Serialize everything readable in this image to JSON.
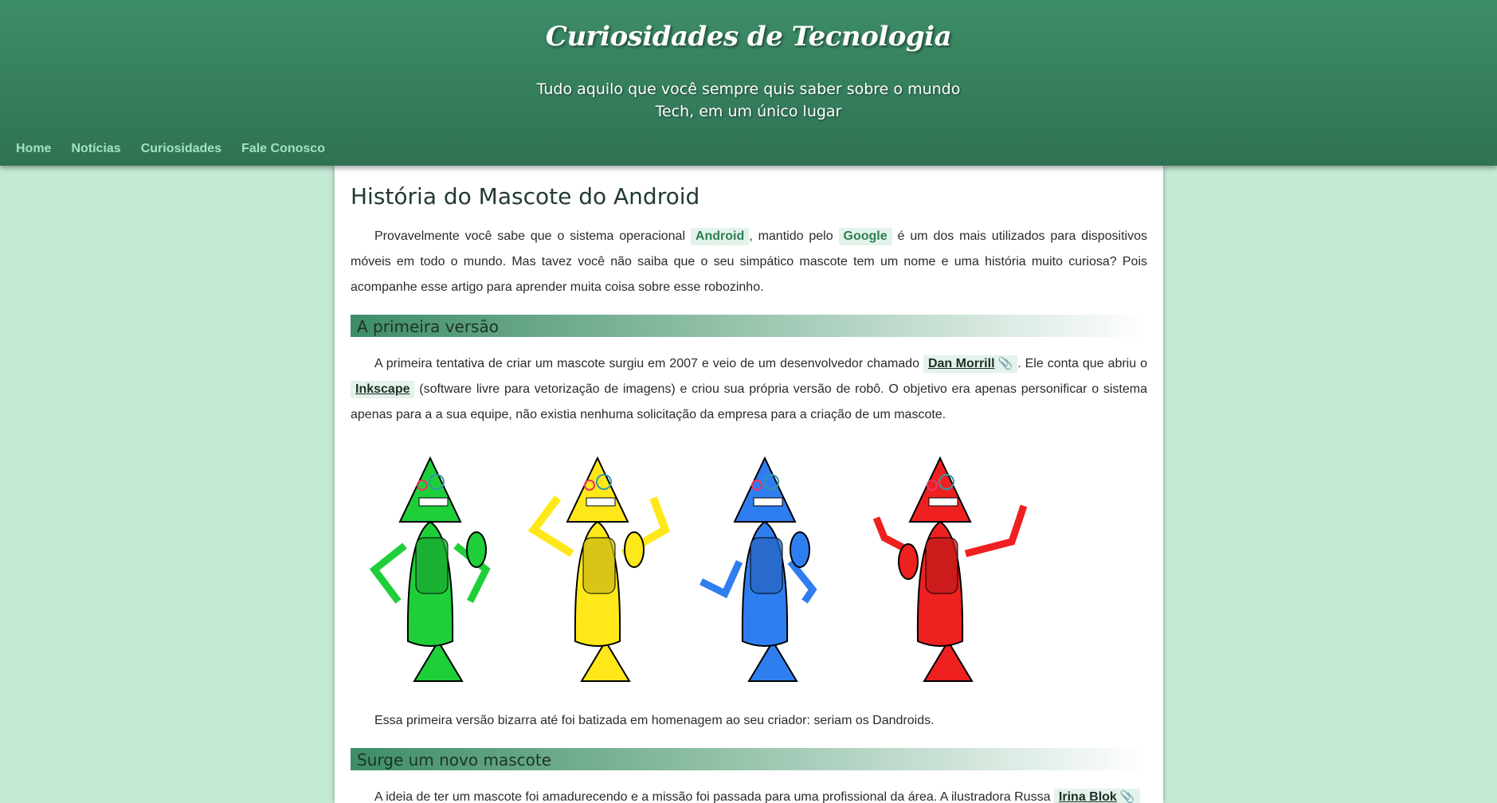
{
  "site": {
    "title": "Curiosidades de Tecnologia",
    "subtitle_line1": "Tudo aquilo que você sempre quis saber sobre o mundo",
    "subtitle_line2": "Tech, em um único lugar"
  },
  "nav": {
    "items": [
      {
        "label": "Home"
      },
      {
        "label": "Notícias"
      },
      {
        "label": "Curiosidades"
      },
      {
        "label": "Fale Conosco"
      }
    ]
  },
  "article": {
    "title": "História do Mascote do Android",
    "intro": {
      "t1": "Provavelmente você sabe que o sistema operacional ",
      "link1": "Android",
      "t2": ", mantido pelo ",
      "link2": "Google",
      "t3": " é um dos mais utilizados para dispositivos móveis em todo o mundo. Mas tavez você não saiba que o seu simpático mascote tem um nome e uma história muito curiosa? Pois acompanhe esse artigo para aprender muita coisa sobre esse robozinho."
    },
    "section1": {
      "heading": "A primeira versão",
      "p1": {
        "t1": "A primeira tentativa de criar um mascote surgiu em 2007 e veio de um desenvolvedor chamado ",
        "link1": "Dan Morrill",
        "t2": ". Ele conta que abriu o ",
        "link2": "Inkscape",
        "t3": " (software livre para vetorização de imagens) e criou sua própria versão de robô. O objetivo era apenas personificar o sistema apenas para a a sua equipe, não existia nenhuma solicitação da empresa para a criação de um mascote."
      },
      "robot_colors": [
        "#1fcf3a",
        "#ffe81a",
        "#2f7ef0",
        "#ef2020"
      ],
      "p2": "Essa primeira versão bizarra até foi batizada em homenagem ao seu criador: seriam os Dandroids."
    },
    "section2": {
      "heading": "Surge um novo mascote",
      "p1": {
        "t1": "A ideia de ter um mascote foi amadurecendo e a missão foi passada para uma profissional da área. A ilustradora Russa ",
        "link1": "Irina Blok"
      }
    },
    "link_icon": "paperclip-icon"
  }
}
